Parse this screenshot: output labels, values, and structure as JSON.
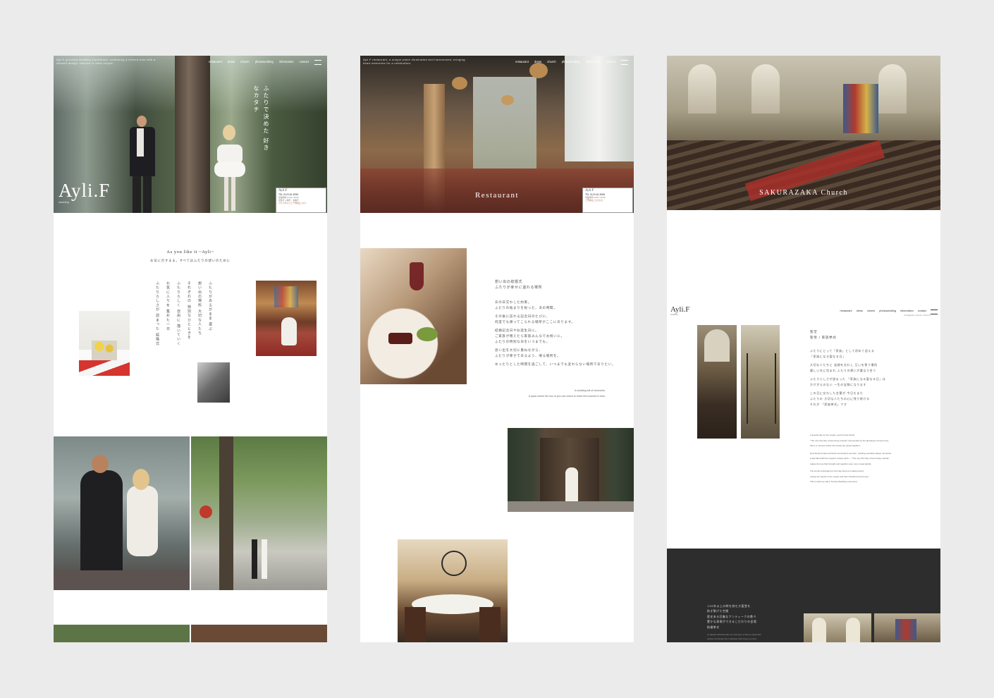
{
  "brand": "Ayli.F",
  "brand_sub": "wedding",
  "nav": [
    "restaurant",
    "dress",
    "church",
    "photowedding",
    "information",
    "contact"
  ],
  "nav_sub": "instagram  photo  church",
  "panel1": {
    "hero_tagline": "ふたりで決めた 好きなカタチ",
    "hero_small": "Ayli.F provides wedding experience, combining a refined tone with a relaxed design, tailored to each couple.",
    "card_title": "Ayli.F",
    "card_phone": "TEL 0120-61-5096",
    "card_lines": [
      "営業時間 11:00〜19:00",
      "定休日 火曜日・水曜日",
      "ブライダルフェア予約はこちら"
    ],
    "intro_title": "As you like it ~Ayli~",
    "intro_sub": "お気に召すまま。すべてはふたりの想いのために",
    "vertical_text": [
      "ふたりがあるがまま 選ぶ",
      "想い出の場所 大切な人たち",
      "それぞれの 特別なひとときを",
      "ふたりらしく 自由に 描いていく",
      "お気に入りを 集めた一日",
      "ふたりらしさが 詰まった 結婚式"
    ]
  },
  "panel2": {
    "hero_small": "Ayli.F restaurant, a unique place illuminated and harmonized, bringing heart memories for a celebration.",
    "hero_title": "Restaurant",
    "card_title": "Ayli.F",
    "card_phone": "TEL 0120-61-5096",
    "card_lines": [
      "営業時間 11:00〜19:00",
      "ご予約はこちらから"
    ],
    "title_lines": [
      "想い出の結婚式",
      "ふたりが幸せに還れる場所"
    ],
    "body_lines": [
      "あの日交わした約束。",
      "ふたりの始まりを祝った、あの時間。",
      "",
      "その後に訪れる記念日のたびに、",
      "何度でも帰ってこられる場所がここにあります。",
      "",
      "結婚記念日やお誕生日に。",
      "ご家族が増えたら家族みんなでお祝いに。",
      "ふたりの特別な日をいつまでも。",
      "",
      "思い出を大切に重ねながら、",
      "ふたりが幸せであるよう、帰る場所を。",
      "",
      "ゆったりとした時間を過ごして、いつまでも変わらない場所でありたい。"
    ],
    "caption_lines": [
      "A wedding full of memories.",
      "A place where the two of you can return to relive the moment in time."
    ]
  },
  "panel3": {
    "hero_title": "SAKURAZAKA Church",
    "title_lines": [
      "聖堂",
      "聖母 / 家族挙式"
    ],
    "body_lines": [
      "ふたりにとって「家族」として初めて迎える",
      "「家族になる聖なる日」",
      "",
      "大切な人たちと 笑顔を交わし 互いを誓う場所",
      "優しい光に包まれ ふたりの想いが重なり合う",
      "",
      "ふたりらしさが詰まった 「家族になる聖なる日」は",
      "かけがえのない 一生の宝物になります",
      "",
      "この日に交わした言葉が 今日もまた",
      "ふたりの 大切な人たちの心に残り続ける",
      "それが 「家族挙式」です"
    ],
    "en_lines": [
      "A special day for the couple, and for their family.",
      "\"The very first day of becoming a family\" Surrounded by the blessings of loved ones,",
      "this is a moment where the hearts are joined together.",
      "",
      "How family bonds and kinds connections are born, creating countless happy memories.",
      "A day filled with the couple's unique spirit — \"The very first day of becoming a family\"",
      "makes the ties that brought and together even more meaningfully.",
      "",
      "The words exchanged on this day become a lasting bond,",
      "resting the hearts of the couple and their cherished loved ones.",
      "This is what we call a \"Family Wedding Ceremony\"."
    ],
    "dark_lines": [
      "130年以上の時を刻む大聖堂を",
      "紡ぎ繋げた空間",
      "歴史ある荘厳なアンティークの数々",
      "豊かな表現ができるこだわりの会場",
      "結婚挙式"
    ],
    "dark_en_lines": [
      "A majestic cathedral with over 100 years of history, linked with",
      "antique furnishings full of character that brings you home"
    ]
  }
}
